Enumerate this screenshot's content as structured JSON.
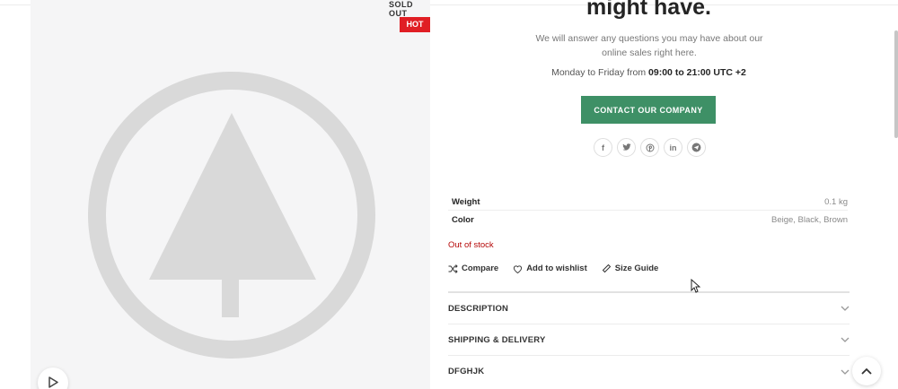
{
  "gallery": {
    "sold_out": "SOLD OUT",
    "hot": "HOT",
    "placeholder_icon": "tree-placeholder-icon",
    "play_icon": "play-icon"
  },
  "contact": {
    "heading": "might have.",
    "intro": "We will answer any questions you may have about our online sales right here.",
    "hours_prefix": "Monday to Friday from ",
    "hours_value": "09:00 to 21:00 UTC +2",
    "button_label": "CONTACT OUR COMPANY",
    "button_color": "#3e9066",
    "socials": [
      {
        "icon": "facebook-icon",
        "glyph": "f"
      },
      {
        "icon": "twitter-icon",
        "glyph": "t"
      },
      {
        "icon": "pinterest-icon",
        "glyph": "p"
      },
      {
        "icon": "linkedin-icon",
        "glyph": "in"
      },
      {
        "icon": "telegram-icon",
        "glyph": "➤"
      }
    ]
  },
  "attributes": [
    {
      "label": "Weight",
      "value": "0.1 kg"
    },
    {
      "label": "Color",
      "value": "Beige, Black, Brown"
    }
  ],
  "stock_status": "Out of stock",
  "stock_color": "#b50808",
  "actions": {
    "compare": "Compare",
    "wishlist": "Add to wishlist",
    "size_guide": "Size Guide"
  },
  "accordion": [
    {
      "title": "DESCRIPTION"
    },
    {
      "title": "SHIPPING & DELIVERY"
    },
    {
      "title": "DFGHJK"
    }
  ]
}
